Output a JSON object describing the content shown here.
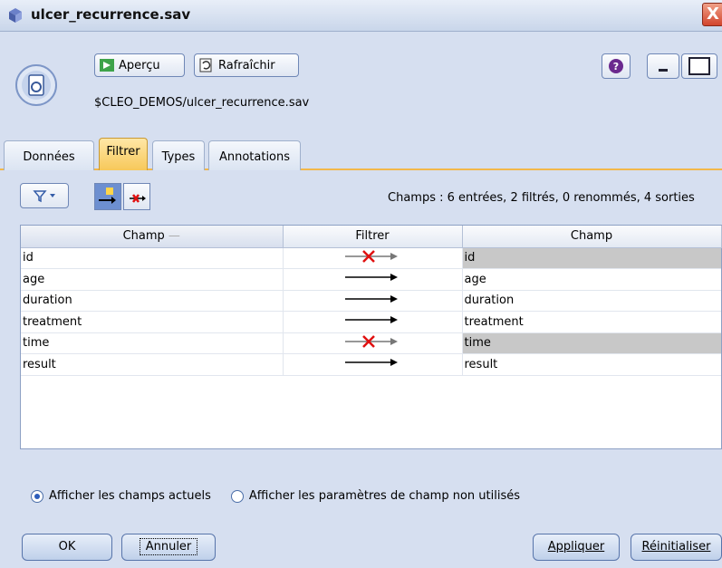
{
  "window": {
    "title": "ulcer_recurrence.sav",
    "close_label": "X"
  },
  "toolbar": {
    "preview_label": "Aperçu",
    "refresh_label": "Rafraîchir",
    "help_label": "?",
    "file_path": "$CLEO_DEMOS/ulcer_recurrence.sav"
  },
  "tabs": [
    {
      "label": "Données",
      "active": false
    },
    {
      "label": "Filtrer",
      "active": true
    },
    {
      "label": "Types",
      "active": false
    },
    {
      "label": "Annotations",
      "active": false
    }
  ],
  "summary": "Champs : 6 entrées, 2 filtrés, 0 renommés, 4 sorties",
  "table": {
    "headers": [
      "Champ",
      "Filtrer",
      "Champ"
    ],
    "rows": [
      {
        "in": "id",
        "filtered": true,
        "out": "id"
      },
      {
        "in": "age",
        "filtered": false,
        "out": "age"
      },
      {
        "in": "duration",
        "filtered": false,
        "out": "duration"
      },
      {
        "in": "treatment",
        "filtered": false,
        "out": "treatment"
      },
      {
        "in": "time",
        "filtered": true,
        "out": "time"
      },
      {
        "in": "result",
        "filtered": false,
        "out": "result"
      }
    ]
  },
  "options": {
    "current_fields": "Afficher les champs actuels",
    "unused_settings": "Afficher les paramètres de champ non utilisés",
    "selected": "current_fields"
  },
  "buttons": {
    "ok": "OK",
    "cancel": "Annuler",
    "apply": "Appliquer",
    "reset": "Réinitialiser"
  },
  "colors": {
    "active_tab": "#f7c85a",
    "filtered_cell": "#c8c8c8",
    "filter_x": "#e01010"
  }
}
